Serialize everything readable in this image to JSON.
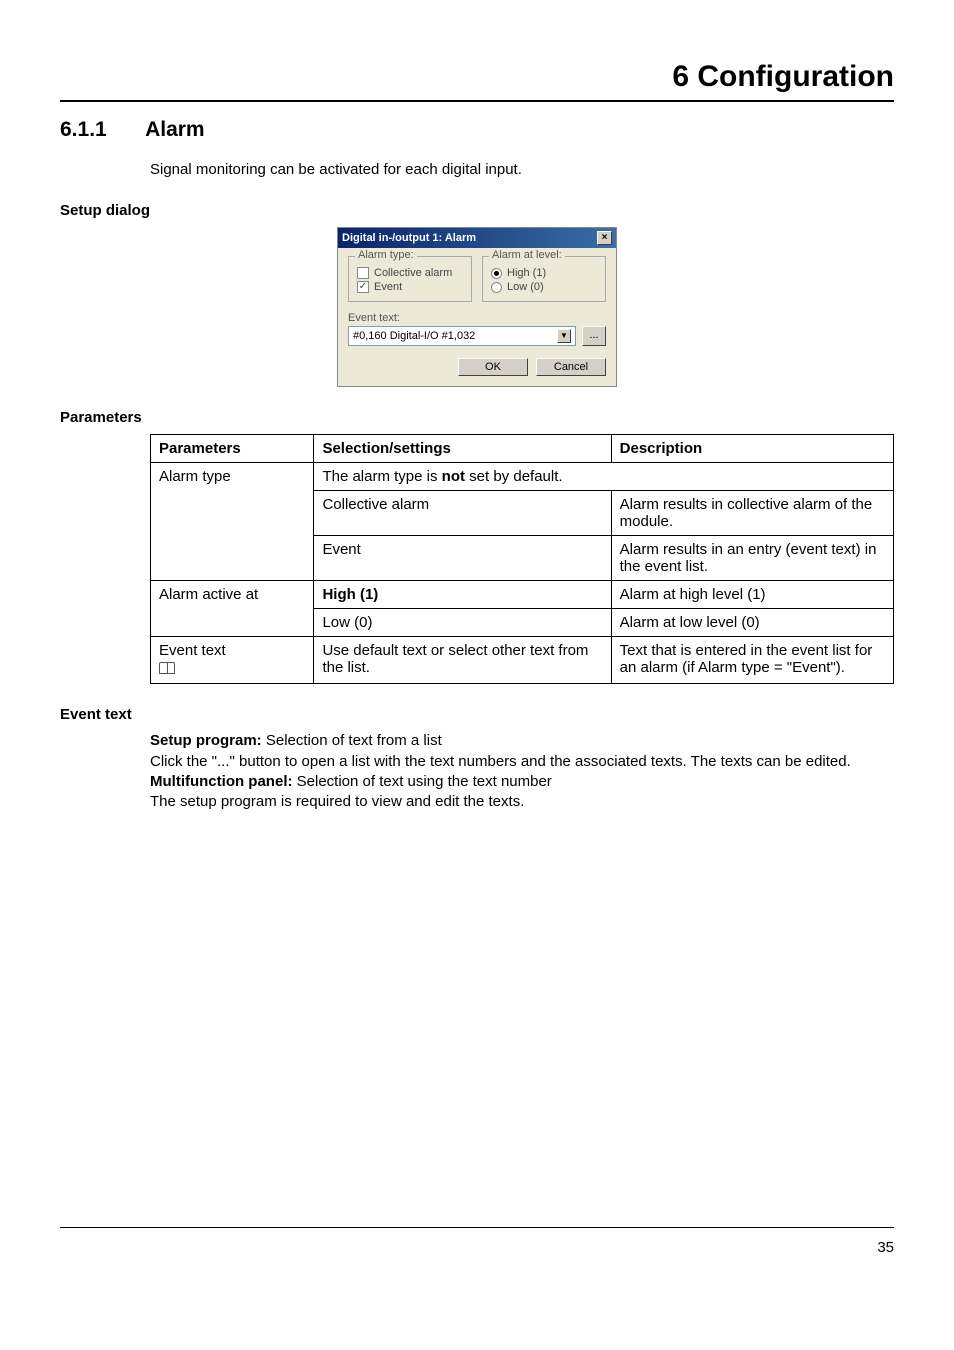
{
  "header": {
    "chapter_title": "6 Configuration"
  },
  "section": {
    "number": "6.1.1",
    "title": "Alarm"
  },
  "intro": "Signal monitoring can be activated for each digital input.",
  "sub": {
    "setup_dialog": "Setup dialog",
    "parameters": "Parameters",
    "event_text": "Event text"
  },
  "dialog": {
    "title": "Digital in-/output 1: Alarm",
    "group_alarm_type": "Alarm type:",
    "opt_collective": "Collective alarm",
    "opt_event": "Event",
    "group_level": "Alarm at level:",
    "opt_high": "High (1)",
    "opt_low": "Low (0)",
    "event_text_label": "Event text:",
    "combo_value": "#0,160 Digital-I/O #1,032",
    "dots": "...",
    "ok": "OK",
    "cancel": "Cancel",
    "close": "×"
  },
  "table": {
    "headers": {
      "parameters": "Parameters",
      "selection": "Selection/settings",
      "description": "Description"
    },
    "row_alarm_type": {
      "name": "Alarm type",
      "default_prefix": "The alarm type is ",
      "default_bold": "not",
      "default_suffix": " set by default.",
      "r1_sel": "Collective alarm",
      "r1_desc": "Alarm results in collective alarm of the module.",
      "r2_sel": "Event",
      "r2_desc": "Alarm results in an entry (event text) in the event list."
    },
    "row_alarm_active": {
      "name": "Alarm active at",
      "r1_sel": "High (1)",
      "r1_desc": "Alarm at high level (1)",
      "r2_sel": "Low (0)",
      "r2_desc": "Alarm at low level (0)"
    },
    "row_event_text": {
      "name": "Event text",
      "sel": "Use default text or select other text from the list.",
      "desc": "Text that is entered in the event list for an alarm (if Alarm type = \"Event\")."
    }
  },
  "event_text_section": {
    "setup_label": "Setup program:",
    "setup_rest": " Selection of text from a list",
    "p1": "Click the \"...\" button to open a list with the text numbers and the associated texts. The texts can be edited.",
    "mf_label": "Multifunction panel:",
    "mf_rest": " Selection of text using the text number",
    "p2": "The setup program is required to view and edit the texts."
  },
  "page_number": "35"
}
